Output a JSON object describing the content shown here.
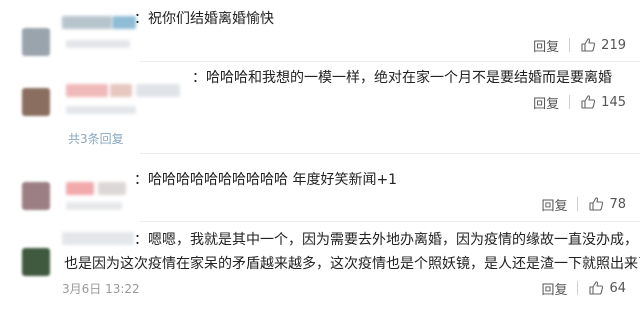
{
  "comments": [
    {
      "username": "",
      "text": "：祝你们结婚离婚愉快",
      "reply_label": "回复",
      "likes": "219",
      "like_icon": "thumbs-up-icon",
      "avatar_color": "#9aa4ad"
    },
    {
      "username": "",
      "text": "：哈哈哈和我想的一模一样，绝对在家一个月不是要结婚而是要离婚",
      "reply_label": "回复",
      "likes": "145",
      "like_icon": "thumbs-up-icon",
      "more_replies": "共3条回复",
      "avatar_color": "#8a6f60"
    },
    {
      "username": "",
      "text": "：哈哈哈哈哈哈哈哈哈哈 年度好笑新闻+1",
      "reply_label": "回复",
      "likes": "78",
      "like_icon": "thumbs-up-icon",
      "avatar_color": "#9b7f84"
    },
    {
      "username": "",
      "text_line1": "：嗯嗯，我就是其中一个，因为需要去外地办离婚，因为疫情的缘故一直没办成，",
      "text_line2": "也是因为这次疫情在家呆的矛盾越来越多，这次疫情也是个照妖镜，是人还是渣一下就照出来了",
      "time": "3月6日 13:22",
      "reply_label": "回复",
      "likes": "64",
      "like_icon": "thumbs-up-icon",
      "avatar_color": "#3f5a3f"
    }
  ],
  "colors": {
    "link": "#8aa8c2",
    "meta": "#999999",
    "text": "#222222"
  }
}
